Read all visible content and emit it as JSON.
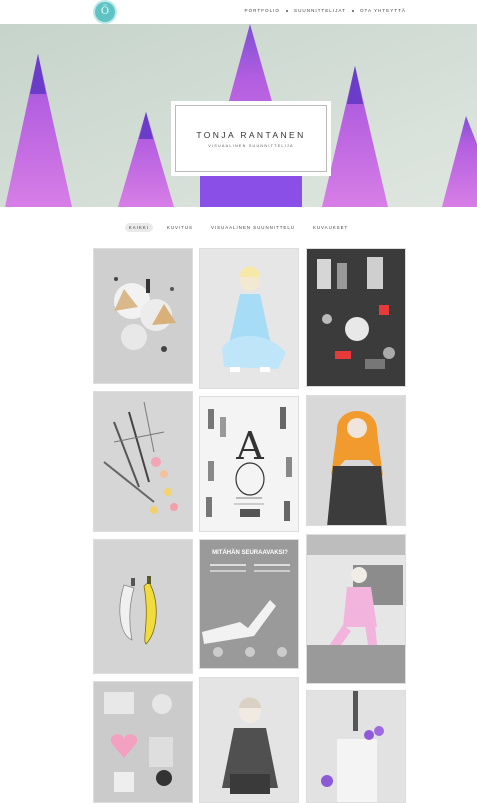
{
  "site": {
    "logo_icon": "teal-monogram-logo-icon",
    "logo_letter": "Ö"
  },
  "nav": {
    "items": [
      "PORTFOLIO",
      "SUUNNITTELIJAT",
      "OTA YHTEYTTÄ"
    ]
  },
  "hero": {
    "title": "TONJA RANTANEN",
    "subtitle": "VISUAALINEN SUUNNITTELIJA"
  },
  "filters": {
    "items": [
      "KAIKKI",
      "KUVITUS",
      "VISUAALINEN SUUNNITTELU",
      "KUVAUKSET"
    ],
    "active": "KAIKKI"
  },
  "gallery": {
    "tiles": [
      {
        "name": "flatlay-icecream-cones-photo"
      },
      {
        "name": "woman-blue-tulle-dress-photo"
      },
      {
        "name": "cosmetics-red-accents-photo"
      },
      {
        "name": "flowers-and-pens-flatlay-photo"
      },
      {
        "name": "fashion-illustration-poster"
      },
      {
        "name": "orange-hair-woman-leather-photo"
      },
      {
        "name": "yellow-banana-photo"
      },
      {
        "name": "infographic-poster",
        "heading": "MITÄHÄN SEURAAVAKSI?"
      },
      {
        "name": "pink-suit-car-photo"
      },
      {
        "name": "pink-objects-flatlay-photo"
      },
      {
        "name": "woman-denim-portrait-photo"
      },
      {
        "name": "purple-flower-milkshake-photo"
      }
    ]
  }
}
